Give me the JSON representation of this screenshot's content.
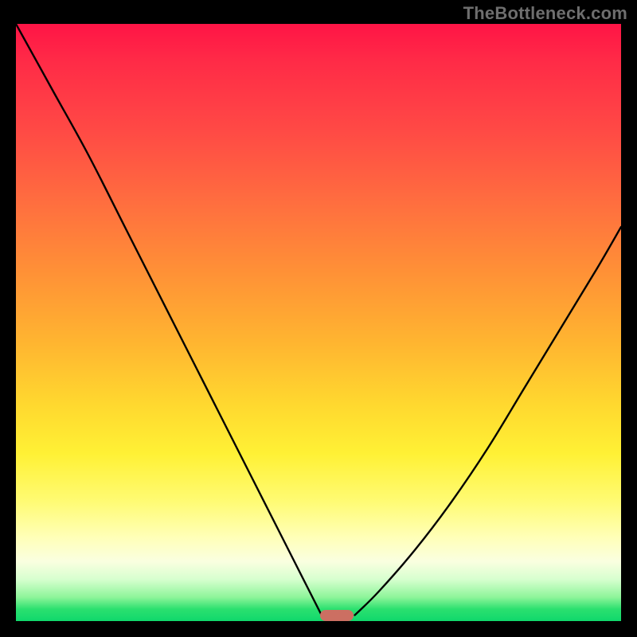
{
  "watermark": "TheBottleneck.com",
  "chart_data": {
    "type": "line",
    "title": "",
    "xlabel": "",
    "ylabel": "",
    "x_range": [
      0,
      100
    ],
    "y_range": [
      0,
      100
    ],
    "grid": false,
    "legend": false,
    "series": [
      {
        "name": "left-branch",
        "x": [
          0,
          6,
          12,
          18,
          24,
          30,
          36,
          42,
          48,
          50.5
        ],
        "y": [
          100,
          89,
          78,
          66,
          54,
          42,
          30,
          18,
          6,
          1
        ]
      },
      {
        "name": "right-branch",
        "x": [
          56,
          60,
          66,
          72,
          78,
          84,
          90,
          96,
          100
        ],
        "y": [
          1,
          5,
          12,
          20,
          29,
          39,
          49,
          59,
          66
        ]
      }
    ],
    "annotations": [
      {
        "name": "bottleneck-marker",
        "x": 53,
        "y": 1
      }
    ],
    "background_gradient": {
      "orientation": "vertical",
      "stops": [
        {
          "pos": 0.0,
          "color": "#ff1446"
        },
        {
          "pos": 0.3,
          "color": "#ff6e3f"
        },
        {
          "pos": 0.55,
          "color": "#ffb730"
        },
        {
          "pos": 0.72,
          "color": "#fff135"
        },
        {
          "pos": 0.9,
          "color": "#faffe0"
        },
        {
          "pos": 1.0,
          "color": "#10d86c"
        }
      ]
    }
  }
}
